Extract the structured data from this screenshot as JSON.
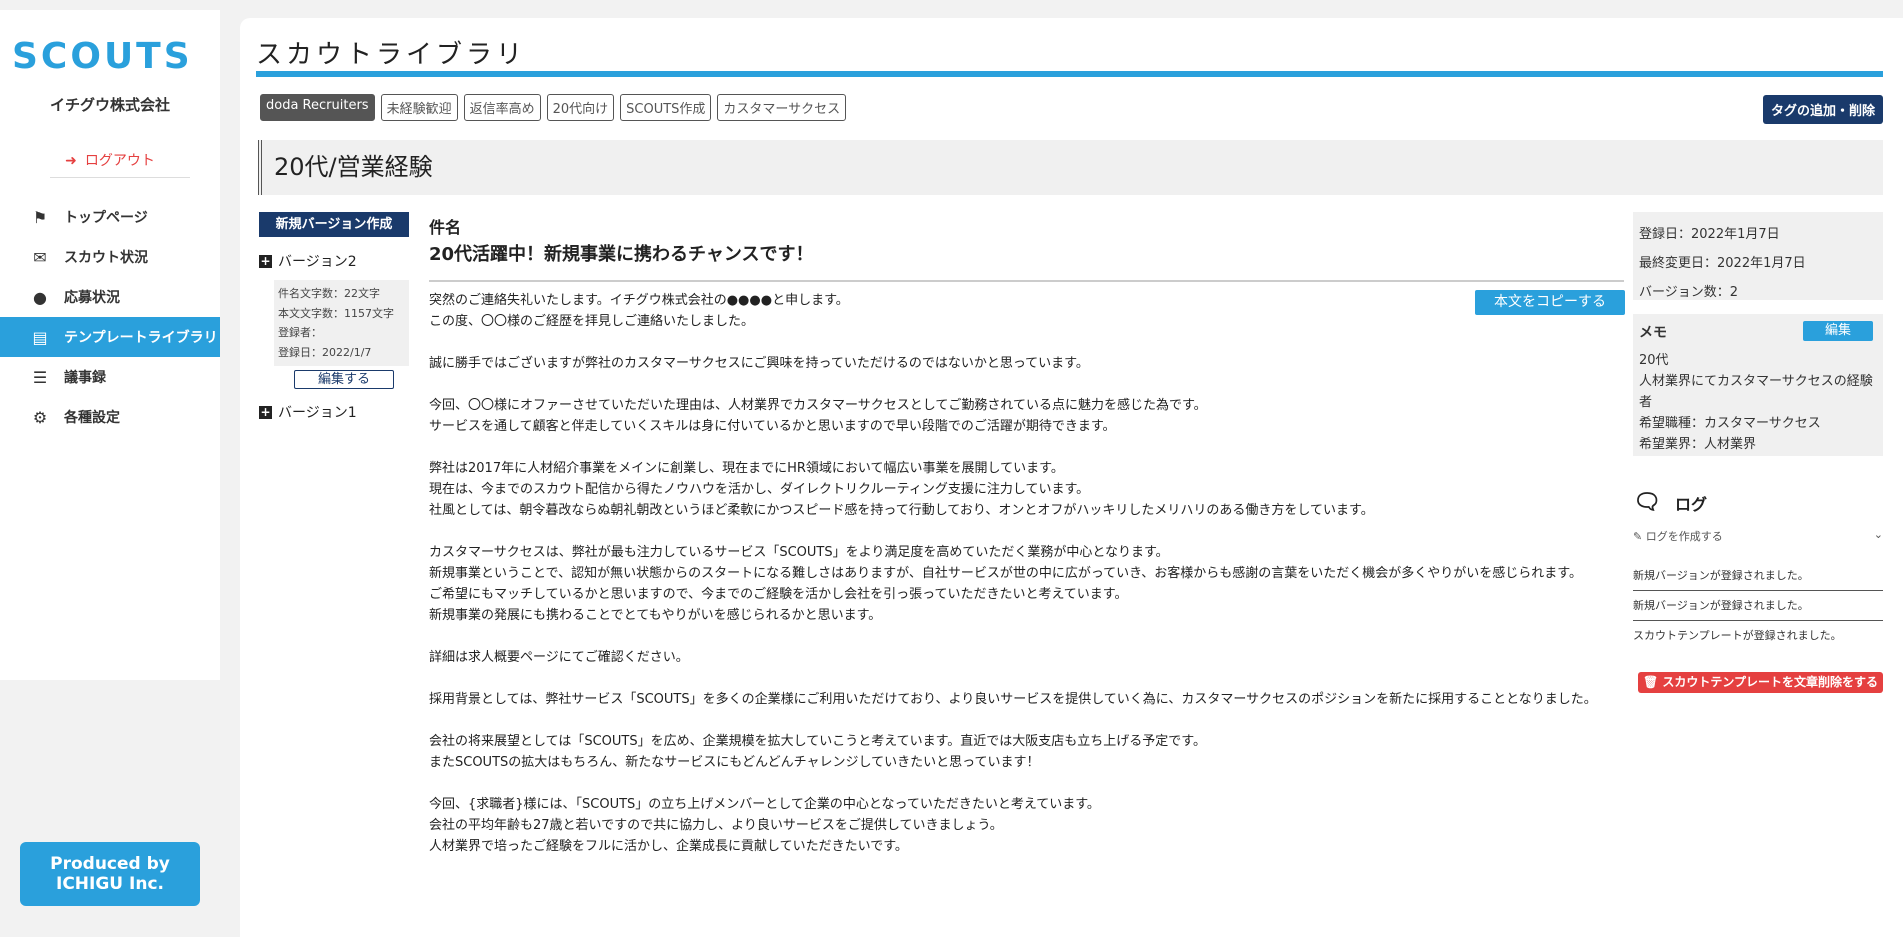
{
  "sidebar": {
    "logo": "SCOUTS",
    "company": "イチグウ株式会社",
    "logout": "ログアウト",
    "items": [
      {
        "label": "トップページ",
        "icon": "flag-icon"
      },
      {
        "label": "スカウト状況",
        "icon": "envelope-icon"
      },
      {
        "label": "応募状況",
        "icon": "user-icon"
      },
      {
        "label": "テンプレートライブラリ",
        "icon": "book-icon",
        "active": true
      },
      {
        "label": "議事録",
        "icon": "list-icon"
      },
      {
        "label": "各種設定",
        "icon": "gear-icon"
      }
    ],
    "produced_by_line1": "Produced by",
    "produced_by_line2": "ICHIGU Inc."
  },
  "header": {
    "title": "スカウトライブラリ"
  },
  "tags": {
    "items": [
      "doda Recruiters",
      "未経験歓迎",
      "返信率高め",
      "20代向け",
      "SCOUTS作成",
      "カスタマーサクセス"
    ],
    "edit_button": "タグの追加・削除"
  },
  "template": {
    "heading": "20代/営業経験"
  },
  "versions": {
    "new_button": "新規バージョン作成",
    "items": [
      {
        "label": "バージョン2"
      },
      {
        "label": "バージョン1"
      }
    ],
    "info": {
      "subject_chars": "件名文字数：22文字",
      "body_chars": "本文文字数：1157文字",
      "registrant": "登録者：",
      "registered": "登録日：2022/1/7"
    },
    "edit_button": "編集する"
  },
  "content": {
    "subject_label": "件名",
    "subject": "20代活躍中！新規事業に携わるチャンスです！",
    "copy_button": "本文をコピーする",
    "body": [
      "突然のご連絡失礼いたします。イチグウ株式会社の●●●●と申します。",
      "この度、〇〇様のご経歴を拝見しご連絡いたしました。",
      "",
      "誠に勝手ではございますが弊社のカスタマーサクセスにご興味を持っていただけるのではないかと思っています。",
      "",
      "今回、〇〇様にオファーさせていただいた理由は、人材業界でカスタマーサクセスとしてご勤務されている点に魅力を感じた為です。",
      "サービスを通して顧客と伴走していくスキルは身に付いているかと思いますので早い段階でのご活躍が期待できます。",
      "",
      "弊社は2017年に人材紹介事業をメインに創業し、現在までにHR領域において幅広い事業を展開しています。",
      "現在は、今までのスカウト配信から得たノウハウを活かし、ダイレクトリクルーティング支援に注力しています。",
      "社風としては、朝令暮改ならぬ朝礼朝改というほど柔軟にかつスピード感を持って行動しており、オンとオフがハッキリしたメリハリのある働き方をしています。",
      "",
      "カスタマーサクセスは、弊社が最も注力しているサービス「SCOUTS」をより満足度を高めていただく業務が中心となります。",
      "新規事業ということで、認知が無い状態からのスタートになる難しさはありますが、自社サービスが世の中に広がっていき、お客様からも感謝の言葉をいただく機会が多くやりがいを感じられます。",
      "ご希望にもマッチしているかと思いますので、今までのご経験を活かし会社を引っ張っていただきたいと考えています。",
      "新規事業の発展にも携わることでとてもやりがいを感じられるかと思います。",
      "",
      "詳細は求人概要ページにてご確認ください。",
      "",
      "採用背景としては、弊社サービス「SCOUTS」を多くの企業様にご利用いただけており、より良いサービスを提供していく為に、カスタマーサクセスのポジションを新たに採用することとなりました。",
      "",
      "会社の将来展望としては「SCOUTS」を広め、企業規模を拡大していこうと考えています。直近では大阪支店も立ち上げる予定です。",
      "またSCOUTSの拡大はもちろん、新たなサービスにもどんどんチャレンジしていきたいと思っています！",
      "",
      "今回、{求職者}様には、「SCOUTS」の立ち上げメンバーとして企業の中心となっていただきたいと考えています。",
      "会社の平均年齢も27歳と若いですので共に協力し、より良いサービスをご提供していきましょう。",
      "人材業界で培ったご経験をフルに活かし、企業成長に貢献していただきたいです。"
    ]
  },
  "meta": {
    "registered": "登録日：2022年1月7日",
    "updated": "最終変更日：2022年1月7日",
    "version_count": "バージョン数：2"
  },
  "memo": {
    "title": "メモ",
    "edit_button": "編集",
    "lines": [
      "20代",
      "人材業界にてカスタマーサクセスの経験者",
      "希望職種：カスタマーサクセス",
      "希望業界：人材業界"
    ]
  },
  "log": {
    "title": "ログ",
    "create_label": "ログを作成する",
    "items": [
      "新規バージョンが登録されました。",
      "新規バージョンが登録されました。",
      "スカウトテンプレートが登録されました。"
    ]
  },
  "delete_button": "スカウトテンプレートを文章削除をする",
  "colors": {
    "accent": "#2aa0dc",
    "navy": "#1a3a6b",
    "danger": "#e54040"
  }
}
